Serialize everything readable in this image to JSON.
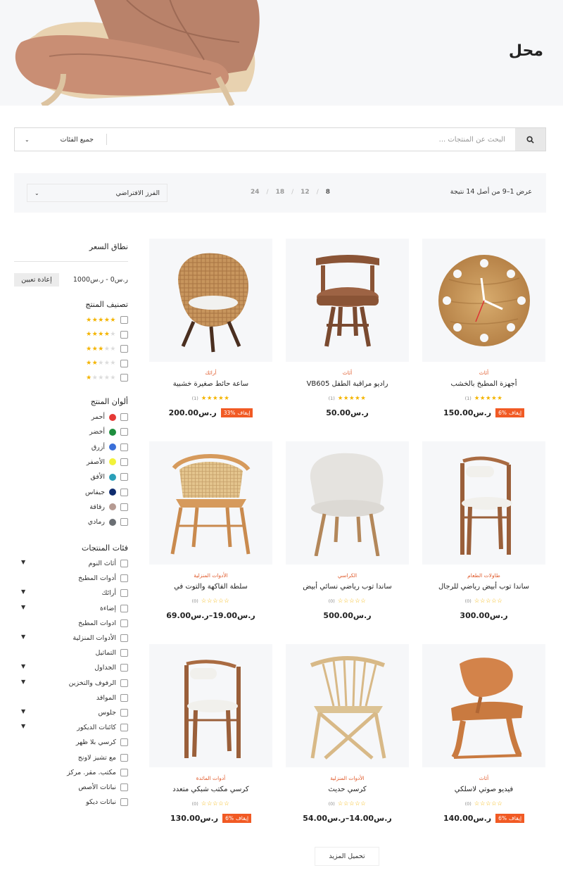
{
  "hero": {
    "title": "محل"
  },
  "search": {
    "placeholder": "البحث عن المنتجات ...",
    "category": "جميع الفئات"
  },
  "toolbar": {
    "result_count": "عرض 1–9 من أصل 14 نتيجة",
    "per_page": [
      "8",
      "12",
      "18",
      "24"
    ],
    "sort": "الفرز الافتراضي"
  },
  "sidebar": {
    "price": {
      "heading": "نطاق السعر",
      "range": "ر.س0 - ر.س1000",
      "reset": "إعادة تعيين"
    },
    "rating": {
      "heading": "تصنيف المنتج",
      "levels": [
        5,
        4,
        3,
        2,
        1
      ]
    },
    "colors": {
      "heading": "ألوان المنتج",
      "items": [
        {
          "label": "أحمر",
          "color": "#e53935"
        },
        {
          "label": "أخضر",
          "color": "#1e8e3e"
        },
        {
          "label": "أزرق",
          "color": "#3a6fd8"
        },
        {
          "label": "الأصفر",
          "color": "#f2f23a"
        },
        {
          "label": "الأفق",
          "color": "#2a9fb8"
        },
        {
          "label": "جيفاس",
          "color": "#0f2c6e"
        },
        {
          "label": "رقاقة",
          "color": "#b59a92"
        },
        {
          "label": "رمادي",
          "color": "#6b6f74"
        }
      ]
    },
    "categories": {
      "heading": "فئات المنتجات",
      "items": [
        {
          "label": "أثاث النوم",
          "expandable": true
        },
        {
          "label": "أدوات المطبخ",
          "expandable": false
        },
        {
          "label": "أرائك",
          "expandable": true
        },
        {
          "label": "إضاءة",
          "expandable": true
        },
        {
          "label": "ادوات المطبخ",
          "expandable": false
        },
        {
          "label": "الأدوات المنزلية",
          "expandable": true
        },
        {
          "label": "التماثيل",
          "expandable": false
        },
        {
          "label": "الجداول",
          "expandable": true
        },
        {
          "label": "الرفوف والتخزين",
          "expandable": true
        },
        {
          "label": "المواقد",
          "expandable": false
        },
        {
          "label": "جلوس",
          "expandable": true
        },
        {
          "label": "كائنات الديكور",
          "expandable": true
        },
        {
          "label": "كرسي بلا ظهر",
          "expandable": false
        },
        {
          "label": "مع تشيز لاونج",
          "expandable": false
        },
        {
          "label": "مكتب. مقر. مركز",
          "expandable": false
        },
        {
          "label": "نباتات الأصص",
          "expandable": false
        },
        {
          "label": "نباتات ديكو",
          "expandable": false
        }
      ]
    }
  },
  "products": [
    {
      "category": "أثاث",
      "name": "أجهزة المطبخ بالخشب",
      "rating": 5,
      "reviews": "(1)",
      "price": "ر.س150.00",
      "badge": {
        "pct": "6%",
        "text": "إيقاف"
      },
      "image": "wall-clock"
    },
    {
      "category": "أثاث",
      "name": "راديو مراقبة الطفل VB605",
      "rating": 5,
      "reviews": "(1)",
      "price": "ر.س50.00",
      "badge": null,
      "image": "leather-swivel-chair"
    },
    {
      "category": "أرائك",
      "name": "ساعة حائط صغيرة خشبية",
      "rating": 5,
      "reviews": "(1)",
      "price": "ر.س200.00",
      "badge": {
        "pct": "33%",
        "text": "إيقاف"
      },
      "image": "wicker-egg-chair"
    },
    {
      "category": "طاولات الطعام",
      "name": "ساندا توب أبيض رياضي للرجال",
      "rating": 0,
      "reviews": "(0)",
      "price": "ر.س300.00",
      "badge": null,
      "image": "wood-armchair"
    },
    {
      "category": "الكراسي",
      "name": "ساندا توب رياضي نسائي أبيض",
      "rating": 0,
      "reviews": "(0)",
      "price": "ر.س500.00",
      "badge": null,
      "image": "upholstered-chair"
    },
    {
      "category": "الأدوات المنزلية",
      "name": "سلطة الفاكهة والتوت في",
      "rating": 0,
      "reviews": "(0)",
      "price": "ر.س19.00–ر.س69.00",
      "badge": null,
      "image": "rattan-armchair"
    },
    {
      "category": "أثاث",
      "name": "فيديو صوتي لاسلكي",
      "rating": 0,
      "reviews": "(0)",
      "price": "ر.س140.00",
      "badge": {
        "pct": "6%",
        "text": "إيقاف"
      },
      "image": "plywood-lounge-chair"
    },
    {
      "category": "الأدوات المنزلية",
      "name": "كرسي حديث",
      "rating": 0,
      "reviews": "(0)",
      "price": "ر.س14.00–ر.س54.00",
      "badge": null,
      "image": "spindle-chair"
    },
    {
      "category": "أدوات المائدة",
      "name": "كرسي مكتب شبكي متعدد",
      "rating": 0,
      "reviews": "(0)",
      "price": "ر.س130.00",
      "badge": {
        "pct": "6%",
        "text": "إيقاف"
      },
      "image": "wood-armchair-2"
    }
  ],
  "load_more": "تحميل المزيد",
  "colors": {
    "accent": "#f15a24",
    "star": "#f4b400",
    "panel": "#f6f7f9"
  }
}
